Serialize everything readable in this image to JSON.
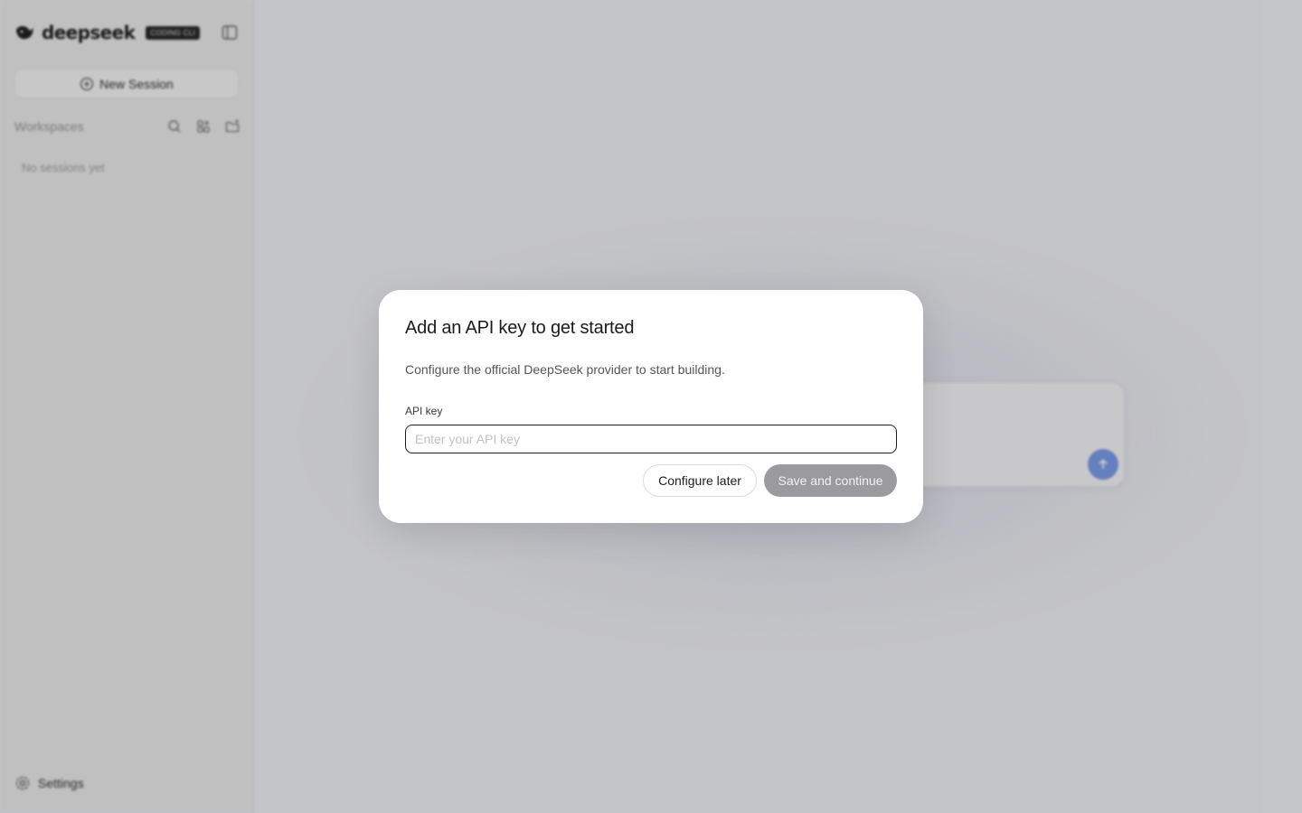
{
  "sidebar": {
    "brand_name": "deepseek",
    "brand_badge": "CODING CLI",
    "new_session_label": "New Session",
    "workspaces_label": "Workspaces",
    "empty_text": "No sessions yet",
    "settings_label": "Settings"
  },
  "modal": {
    "title": "Add an API key to get started",
    "description": "Configure the official DeepSeek provider to start building.",
    "api_key_label": "API key",
    "api_key_placeholder": "Enter your API key",
    "api_key_value": "",
    "configure_later_label": "Configure later",
    "save_label": "Save and continue"
  },
  "colors": {
    "send_button": "#7fa0ee",
    "save_button_disabled": "#9b9b9f",
    "overlay": "rgba(0,0,0,0.2)"
  },
  "icons": {
    "brand": "whale-logo-icon",
    "collapse": "sidebar-toggle-icon",
    "new_session": "plus-circle-icon",
    "search": "search-icon",
    "new_workspace": "workspace-add-icon",
    "new_folder": "folder-add-icon",
    "settings": "gear-icon",
    "send": "arrow-up-icon"
  }
}
